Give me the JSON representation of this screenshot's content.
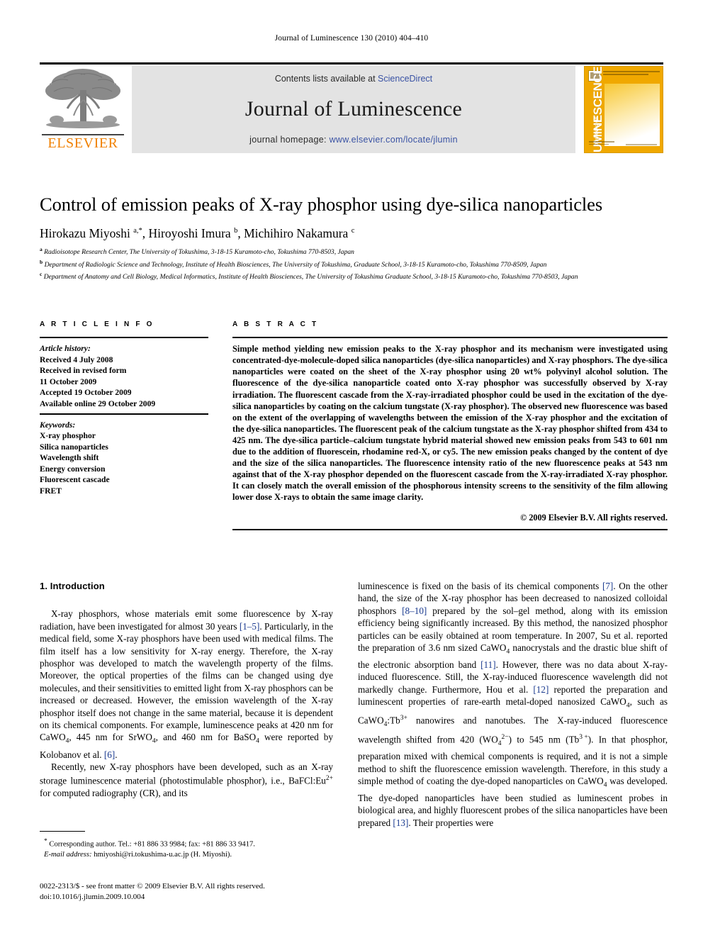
{
  "running_head": "Journal of Luminescence 130 (2010) 404–410",
  "masthead": {
    "contents_prefix": "Contents lists available at ",
    "sciencedirect": "ScienceDirect",
    "journal_title": "Journal of Luminescence",
    "homepage_prefix": "journal homepage: ",
    "homepage_url": "www.elsevier.com/locate/jlumin",
    "publisher_name": "ELSEVIER",
    "cover_title": "LUMINESCENCE",
    "cover_subtitle": "JOURNAL OF",
    "colors": {
      "link": "#3a53a4",
      "elsevier_orange": "#F08000",
      "cover_yellow": "#F0A800",
      "masthead_gray": "#e3e3e3"
    }
  },
  "article": {
    "title": "Control of emission peaks of X-ray phosphor using dye-silica nanoparticles",
    "authors_html": "Hirokazu Miyoshi <sup>a,*</sup>, Hiroyoshi Imura <sup>b</sup>, Michihiro Nakamura <sup>c</sup>",
    "affiliations": [
      {
        "marker": "a",
        "text": "Radioisotope Research Center, The University of Tokushima, 3-18-15 Kuramoto-cho, Tokushima 770-8503, Japan"
      },
      {
        "marker": "b",
        "text": "Department of Radiologic Science and Technology, Institute of Health Biosciences, The University of Tokushima, Graduate School, 3-18-15 Kuramoto-cho, Tokushima 770-8509, Japan"
      },
      {
        "marker": "c",
        "text": "Department of Anatomy and Cell Biology, Medical Informatics, Institute of Health Biosciences, The University of Tokushima Graduate School, 3-18-15 Kuramoto-cho, Tokushima 770-8503, Japan"
      }
    ]
  },
  "article_info": {
    "heading": "A R T I C L E   I N F O",
    "history_label": "Article history:",
    "history": [
      "Received 4 July 2008",
      "Received in revised form",
      "11 October 2009",
      "Accepted 19 October 2009",
      "Available online 29 October 2009"
    ],
    "keywords_label": "Keywords:",
    "keywords": [
      "X-ray phosphor",
      "Silica nanoparticles",
      "Wavelength shift",
      "Energy conversion",
      "Fluorescent cascade",
      "FRET"
    ]
  },
  "abstract": {
    "heading": "A B S T R A C T",
    "text": "Simple method yielding new emission peaks to the X-ray phosphor and its mechanism were investigated using concentrated-dye-molecule-doped silica nanoparticles (dye-silica nanoparticles) and X-ray phosphors. The dye-silica nanoparticles were coated on the sheet of the X-ray phosphor using 20 wt% polyvinyl alcohol solution. The fluorescence of the dye-silica nanoparticle coated onto X-ray phosphor was successfully observed by X-ray irradiation. The fluorescent cascade from the X-ray-irradiated phosphor could be used in the excitation of the dye-silica nanoparticles by coating on the calcium tungstate (X-ray phosphor). The observed new fluorescence was based on the extent of the overlapping of wavelengths between the emission of the X-ray phosphor and the excitation of the dye-silica nanoparticles. The fluorescent peak of the calcium tungstate as the X-ray phosphor shifted from 434 to 425 nm. The dye-silica particle–calcium tungstate hybrid material showed new emission peaks from 543 to 601 nm due to the addition of fluorescein, rhodamine red-X, or cy5. The new emission peaks changed by the content of dye and the size of the silica nanoparticles. The fluorescence intensity ratio of the new fluorescence peaks at 543 nm against that of the X-ray phosphor depended on the fluorescent cascade from the X-ray-irradiated X-ray phosphor. It can closely match the overall emission of the phosphorous intensity screens to the sensitivity of the film allowing lower dose X-rays to obtain the same image clarity.",
    "copyright": "© 2009 Elsevier B.V. All rights reserved."
  },
  "body": {
    "section_heading": "1.  Introduction",
    "left_paragraph_1_html": "X-ray phosphors, whose materials emit some fluorescence by X-ray radiation, have been investigated for almost 30 years <span class=\"ref\">[1&#8211;5]</span>. Particularly, in the medical field, some X-ray phosphors have been used with medical films. The film itself has a low sensitivity for X-ray energy. Therefore, the X-ray phosphor was developed to match the wavelength property of the films. Moreover, the optical properties of the films can be changed using dye molecules, and their sensitivities to emitted light from X-ray phosphors can be increased or decreased. However, the emission wavelength of the X-ray phosphor itself does not change in the same material, because it is dependent on its chemical components. For example, luminescence peaks at 420 nm for CaWO<sub>4</sub>, 445 nm for SrWO<sub>4</sub>, and 460 nm for BaSO<sub>4</sub> were reported by Kolobanov et al. <span class=\"ref\">[6]</span>.",
    "left_paragraph_2_html": "Recently, new X-ray phosphors have been developed, such as an X-ray storage luminescence material (photostimulable phosphor), i.e., BaFCl:Eu<sup>2+</sup> for computed radiography (CR), and its",
    "right_paragraph_1_html": "luminescence is fixed on the basis of its chemical components <span class=\"ref\">[7]</span>. On the other hand, the size of the X-ray phosphor has been decreased to nanosized colloidal phosphors <span class=\"ref\">[8&#8211;10]</span> prepared by the sol&#8211;gel method, along with its emission efficiency being significantly increased. By this method, the nanosized phosphor particles can be easily obtained at room temperature. In 2007, Su et al. reported the preparation of 3.6 nm sized CaWO<sub>4</sub> nanocrystals and the drastic blue shift of the electronic absorption band <span class=\"ref\">[11]</span>. However, there was no data about X-ray-induced fluorescence. Still, the X-ray-induced fluorescence wavelength did not markedly change. Furthermore, Hou et al. <span class=\"ref\">[12]</span> reported the preparation and luminescent properties of rare-earth metal-doped nanosized CaWO<sub>4</sub>, such as CaWO<sub>4</sub>:Tb<sup>3+</sup> nanowires and nanotubes. The X-ray-induced fluorescence wavelength shifted from 420 (WO<sub>4</sub><sup>2&#8722;</sup>) to 545 nm (Tb<sup>3&#8197;+</sup>). In that phosphor, preparation mixed with chemical components is required, and it is not a simple method to shift the fluorescence emission wavelength. Therefore, in this study a simple method of coating the dye-doped nanoparticles on CaWO<sub>4</sub> was developed. The dye-doped nanoparticles have been studied as luminescent probes in biological area, and highly fluorescent probes of the silica nanoparticles have been prepared <span class=\"ref\">[13]</span>. Their properties were"
  },
  "footnotes": {
    "corresponding_html": "<sup>*</sup> Corresponding author. Tel.: +81 886 33 9984; fax: +81 886 33 9417.",
    "email_html": "<span class=\"it\">E-mail address:</span> hmiyoshi@ri.tokushima-u.ac.jp (H. Miyoshi).",
    "imprint_line1": "0022-2313/$ - see front matter © 2009 Elsevier B.V. All rights reserved.",
    "imprint_line2": "doi:10.1016/j.jlumin.2009.10.004"
  }
}
